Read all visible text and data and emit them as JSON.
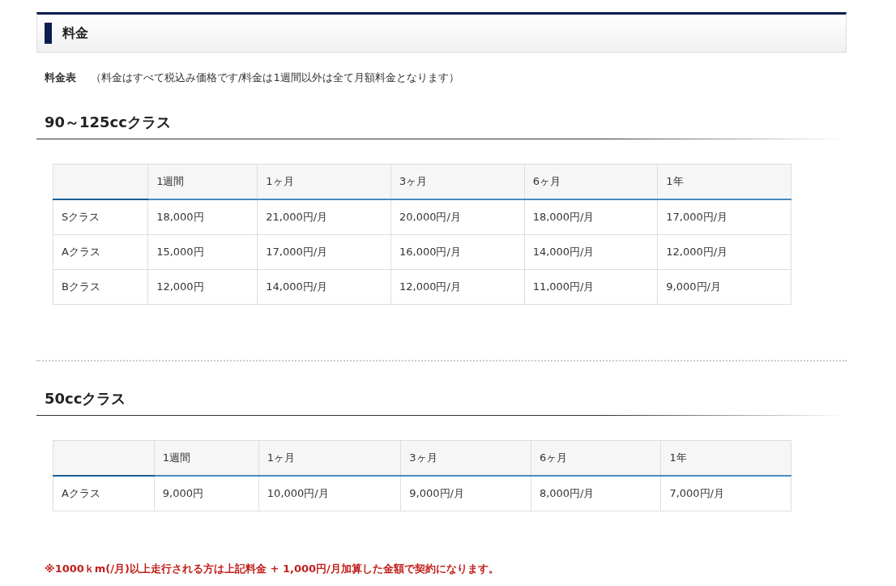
{
  "header": {
    "title": "料金"
  },
  "intro": {
    "label": "料金表",
    "text": "（料金はすべて税込み価格です/料金は1週間以外は全て月額料金となります）"
  },
  "sections": [
    {
      "heading": "90～125ccクラス",
      "columns": [
        "",
        "1週間",
        "1ヶ月",
        "3ヶ月",
        "6ヶ月",
        "1年"
      ],
      "rows": [
        [
          "Sクラス",
          "18,000円",
          "21,000円/月",
          "20,000円/月",
          "18,000円/月",
          "17,000円/月"
        ],
        [
          "Aクラス",
          "15,000円",
          "17,000円/月",
          "16,000円/月",
          "14,000円/月",
          "12,000円/月"
        ],
        [
          "Bクラス",
          "12,000円",
          "14,000円/月",
          "12,000円/月",
          "11,000円/月",
          "9,000円/月"
        ]
      ]
    },
    {
      "heading": "50ccクラス",
      "columns": [
        "",
        "1週間",
        "1ヶ月",
        "3ヶ月",
        "6ヶ月",
        "1年"
      ],
      "rows": [
        [
          "Aクラス",
          "9,000円",
          "10,000円/月",
          "9,000円/月",
          "8,000円/月",
          "7,000円/月"
        ]
      ]
    }
  ],
  "note": "※1000ｋm(/月)以上走行される方は上記料金 + 1,000円/月加算した金額で契約になります。"
}
